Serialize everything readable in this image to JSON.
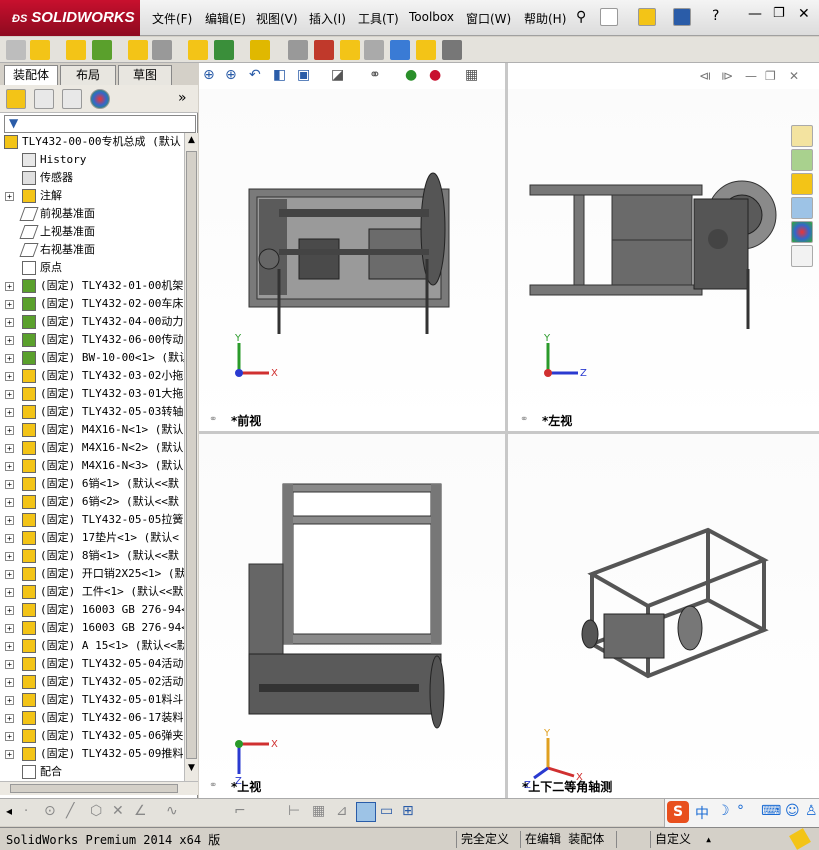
{
  "app": {
    "logo": "SOLIDWORKS",
    "version_status": "SolidWorks Premium 2014 x64 版"
  },
  "menu": [
    "文件(F)",
    "编辑(E)",
    "视图(V)",
    "插入(I)",
    "工具(T)",
    "Toolbox",
    "窗口(W)",
    "帮助(H)"
  ],
  "panel_tabs": [
    "装配体",
    "布局",
    "草图"
  ],
  "tree": [
    {
      "label": "TLY432-00-00专机总成  (默认",
      "expand": "",
      "icon": "assembly-icon"
    },
    {
      "label": "History",
      "expand": "",
      "icon": "history-icon"
    },
    {
      "label": "传感器",
      "expand": "",
      "icon": "sensor-icon"
    },
    {
      "label": "注解",
      "expand": "+",
      "icon": "annotation-icon"
    },
    {
      "label": "前视基准面",
      "expand": "",
      "icon": "plane-icon"
    },
    {
      "label": "上视基准面",
      "expand": "",
      "icon": "plane-icon"
    },
    {
      "label": "右视基准面",
      "expand": "",
      "icon": "plane-icon"
    },
    {
      "label": "原点",
      "expand": "",
      "icon": "origin-icon"
    },
    {
      "label": "(固定) TLY432-01-00机架",
      "expand": "+",
      "icon": "subassembly-icon"
    },
    {
      "label": "(固定) TLY432-02-00车床",
      "expand": "+",
      "icon": "subassembly-icon"
    },
    {
      "label": "(固定) TLY432-04-00动力",
      "expand": "+",
      "icon": "subassembly-icon"
    },
    {
      "label": "(固定) TLY432-06-00传动",
      "expand": "+",
      "icon": "subassembly-icon"
    },
    {
      "label": "(固定) BW-10-00<1> (默认",
      "expand": "+",
      "icon": "subassembly-icon"
    },
    {
      "label": "(固定) TLY432-03-02小拖",
      "expand": "+",
      "icon": "part-icon"
    },
    {
      "label": "(固定) TLY432-03-01大拖",
      "expand": "+",
      "icon": "part-icon"
    },
    {
      "label": "(固定) TLY432-05-03转轴",
      "expand": "+",
      "icon": "part-icon"
    },
    {
      "label": "(固定) M4X16-N<1> (默认",
      "expand": "+",
      "icon": "part-icon"
    },
    {
      "label": "(固定) M4X16-N<2> (默认",
      "expand": "+",
      "icon": "part-icon"
    },
    {
      "label": "(固定) M4X16-N<3> (默认",
      "expand": "+",
      "icon": "part-icon"
    },
    {
      "label": "(固定) 6销<1> (默认<<默",
      "expand": "+",
      "icon": "part-icon"
    },
    {
      "label": "(固定) 6销<2> (默认<<默",
      "expand": "+",
      "icon": "part-icon"
    },
    {
      "label": "(固定) TLY432-05-05拉簧",
      "expand": "+",
      "icon": "part-icon"
    },
    {
      "label": "(固定) 17垫片<1> (默认<",
      "expand": "+",
      "icon": "part-icon"
    },
    {
      "label": "(固定) 8销<1> (默认<<默",
      "expand": "+",
      "icon": "part-icon"
    },
    {
      "label": "(固定) 开口销2X25<1> (默",
      "expand": "+",
      "icon": "part-icon"
    },
    {
      "label": "(固定) 工件<1> (默认<<默",
      "expand": "+",
      "icon": "part-icon"
    },
    {
      "label": "(固定) 16003 GB 276-94<",
      "expand": "+",
      "icon": "part-icon"
    },
    {
      "label": "(固定) 16003 GB 276-94<",
      "expand": "+",
      "icon": "part-icon"
    },
    {
      "label": "(固定) A 15<1> (默认<<默",
      "expand": "+",
      "icon": "part-icon"
    },
    {
      "label": "(固定) TLY432-05-04活动",
      "expand": "+",
      "icon": "part-icon"
    },
    {
      "label": "(固定) TLY432-05-02活动",
      "expand": "+",
      "icon": "part-icon"
    },
    {
      "label": "(固定) TLY432-05-01料斗",
      "expand": "+",
      "icon": "part-icon"
    },
    {
      "label": "(固定) TLY432-06-17装料",
      "expand": "+",
      "icon": "part-icon"
    },
    {
      "label": "(固定) TLY432-05-06弹夹",
      "expand": "+",
      "icon": "part-icon"
    },
    {
      "label": "(固定) TLY432-05-09推料",
      "expand": "+",
      "icon": "part-icon"
    },
    {
      "label": "配合",
      "expand": "",
      "icon": "mates-icon"
    }
  ],
  "viewports": [
    {
      "name": "*前视",
      "axes": [
        "Y",
        "X"
      ]
    },
    {
      "name": "*左视",
      "axes": [
        "Y",
        "Z"
      ]
    },
    {
      "name": "*上视",
      "axes": [
        "X",
        "Z"
      ]
    },
    {
      "name": "*上下二等角轴测",
      "axes": [
        "Y",
        "X",
        "Z"
      ]
    }
  ],
  "status": {
    "defined": "完全定义",
    "editing": "在编辑 装配体",
    "units": "自定义"
  },
  "colors": {
    "accent": "#c8102e",
    "tree_bg": "#ffffff",
    "part_yellow": "#f3c417",
    "model_grey": "#6b6b6b"
  },
  "ime": {
    "label": "中"
  }
}
